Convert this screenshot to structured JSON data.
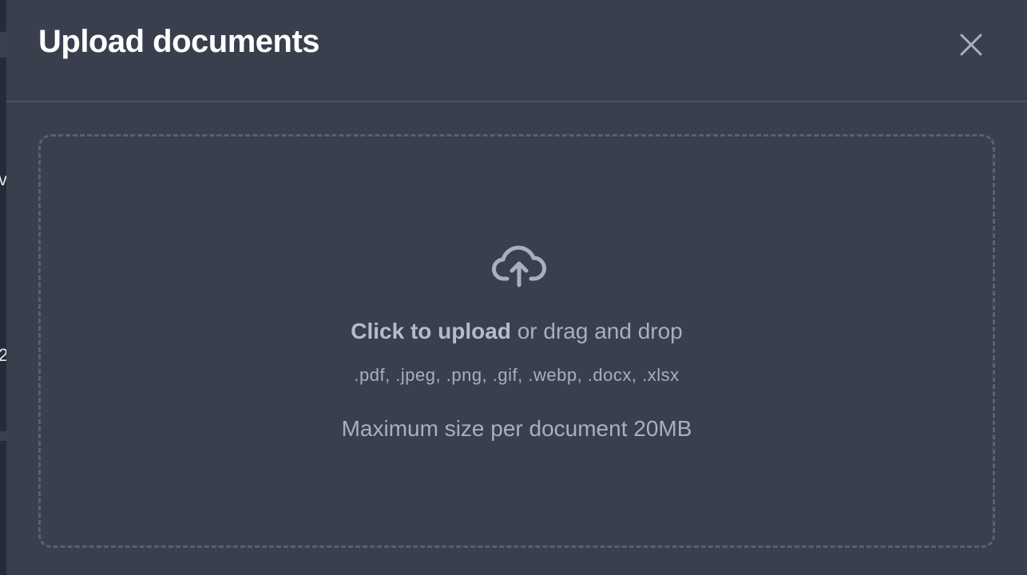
{
  "backdrop": {
    "glyph_top": "v",
    "glyph_bottom": "2"
  },
  "modal": {
    "title": "Upload documents",
    "close_icon": "close-icon",
    "dropzone": {
      "icon": "cloud-upload-icon",
      "click_label": "Click to upload",
      "drag_label": " or drag and drop",
      "formats": ".pdf, .jpeg, .png, .gif, .webp, .docx, .xlsx",
      "max_size": "Maximum size per document 20MB"
    }
  },
  "colors": {
    "modal_bg": "#3a3f4e",
    "title": "#ffffff",
    "muted_text": "#a9afbc",
    "border": "#5a6070"
  }
}
